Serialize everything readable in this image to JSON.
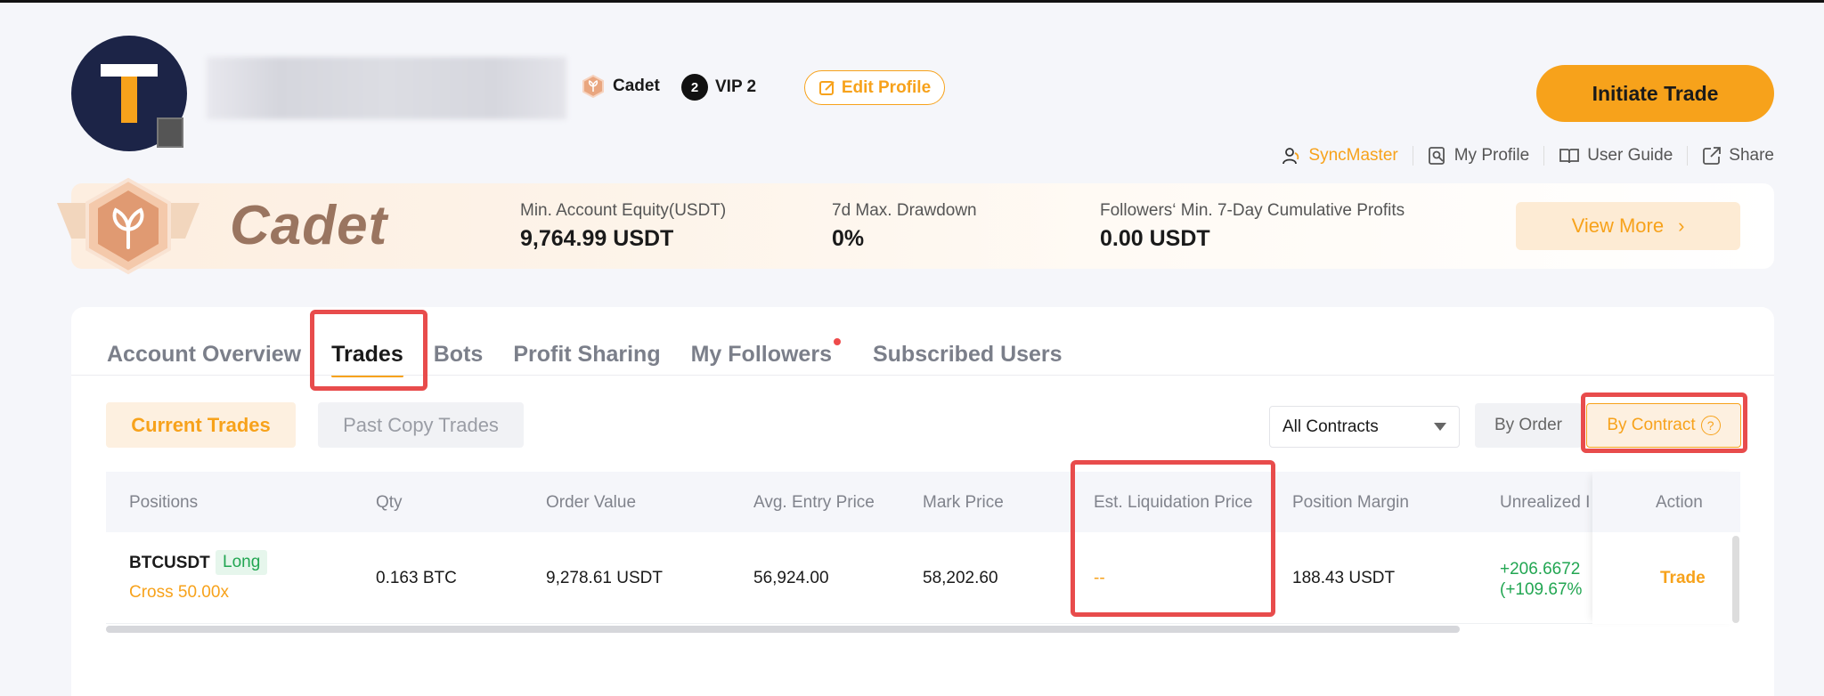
{
  "header": {
    "rank_badge": "Cadet",
    "vip_number": "2",
    "vip_label": "VIP 2",
    "edit_profile": "Edit Profile",
    "initiate_trade": "Initiate Trade",
    "links": [
      {
        "label": "SyncMaster",
        "icon": "user-sync-icon"
      },
      {
        "label": "My Profile",
        "icon": "profile-search-icon"
      },
      {
        "label": "User Guide",
        "icon": "book-icon"
      },
      {
        "label": "Share",
        "icon": "share-icon"
      }
    ]
  },
  "banner": {
    "title": "Cadet",
    "stats": [
      {
        "label": "Min. Account Equity(USDT)",
        "value": "9,764.99 USDT"
      },
      {
        "label": "7d Max. Drawdown",
        "value": "0%"
      },
      {
        "label": "Followers‘ Min. 7-Day Cumulative Profits",
        "value": "0.00 USDT"
      }
    ],
    "view_more": "View More",
    "view_more_chevron": "›"
  },
  "tabs": [
    "Account Overview",
    "Trades",
    "Bots",
    "Profit Sharing",
    "My Followers",
    "Subscribed Users"
  ],
  "subtabs": {
    "current": "Current Trades",
    "past": "Past Copy Trades"
  },
  "filters": {
    "contract_select": "All Contracts",
    "by_order": "By Order",
    "by_contract": "By Contract",
    "help": "?"
  },
  "table": {
    "headers": [
      "Positions",
      "Qty",
      "Order Value",
      "Avg. Entry Price",
      "Mark Price",
      "Est. Liquidation Price",
      "Position Margin",
      "Unrealized I",
      "Action"
    ],
    "row": {
      "symbol": "BTCUSDT",
      "side": "Long",
      "margin_mode": "Cross 50.00x",
      "qty": "0.163 BTC",
      "order_value": "9,278.61 USDT",
      "avg_entry": "56,924.00",
      "mark_price": "58,202.60",
      "liq_price": "--",
      "position_margin": "188.43 USDT",
      "pnl_line1": "+206.6672",
      "pnl_line2": "(+109.67%",
      "action": "Trade"
    }
  },
  "colors": {
    "accent": "#f7a21b",
    "profit": "#22a652",
    "highlight": "#e84c4c"
  }
}
